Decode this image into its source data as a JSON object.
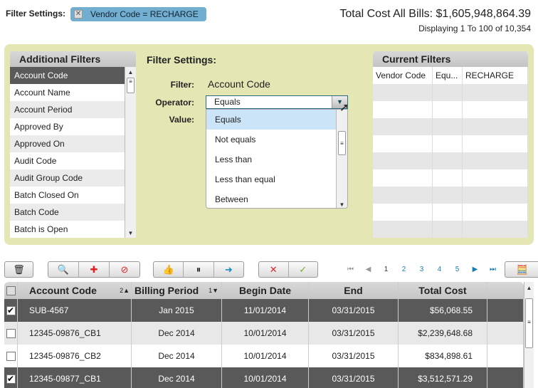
{
  "top": {
    "filter_label": "Filter Settings:",
    "chip_text": "Vendor Code = RECHARGE",
    "total_cost": "Total Cost All Bills: $1,605,948,864.39",
    "displaying": "Displaying 1 To 100 of 10,354"
  },
  "additional_filters": {
    "title": "Additional Filters",
    "items": [
      "Account Code",
      "Account Name",
      "Account Period",
      "Approved By",
      "Approved On",
      "Audit Code",
      "Audit Group Code",
      "Batch Closed On",
      "Batch Code",
      "Batch is Open"
    ]
  },
  "filter_settings": {
    "title": "Filter Settings:",
    "filter_label": "Filter:",
    "filter_value": "Account Code",
    "operator_label": "Operator:",
    "operator_value": "Equals",
    "value_label": "Value:",
    "options": [
      "Equals",
      "Not equals",
      "Less than",
      "Less than equal",
      "Between"
    ]
  },
  "current_filters": {
    "title": "Current Filters",
    "rows": [
      [
        "Vendor Code",
        "Equ...",
        "RECHARGE"
      ]
    ]
  },
  "pagination": {
    "pages": [
      "1",
      "2",
      "3",
      "4",
      "5"
    ],
    "current": "1"
  },
  "grid": {
    "headers": [
      "Account Code",
      "Billing Period",
      "Begin Date",
      "End",
      "Total Cost"
    ],
    "sort": {
      "account_code": "2▲",
      "billing_period": "1▼"
    },
    "rows": [
      {
        "checked": true,
        "cells": [
          "SUB-4567",
          "Jan 2015",
          "11/01/2014",
          "03/31/2015",
          "$56,068.55"
        ]
      },
      {
        "checked": false,
        "cells": [
          "12345-09876_CB1",
          "Dec 2014",
          "10/01/2014",
          "03/31/2015",
          "$2,239,648.68"
        ]
      },
      {
        "checked": false,
        "cells": [
          "12345-09876_CB2",
          "Dec 2014",
          "10/01/2014",
          "03/31/2015",
          "$834,898.61"
        ]
      },
      {
        "checked": true,
        "cells": [
          "12345-09877_CB1",
          "Dec 2014",
          "10/01/2014",
          "03/31/2015",
          "$3,512,571.29"
        ]
      }
    ]
  },
  "colors": {
    "panel": "#e4e6b4",
    "chip": "#72aed0",
    "selected_row": "#595959",
    "highlight_option": "#cce4f8"
  }
}
